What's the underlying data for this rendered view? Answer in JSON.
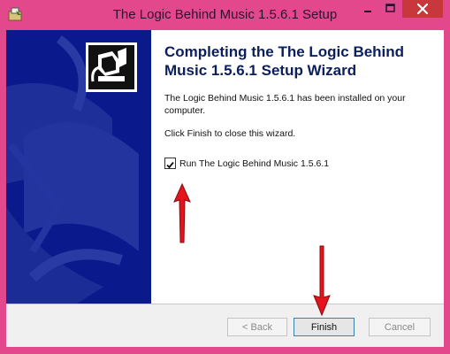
{
  "window": {
    "title": "The Logic Behind Music 1.5.6.1 Setup"
  },
  "wizard": {
    "heading": "Completing the The Logic Behind Music 1.5.6.1 Setup Wizard",
    "installed_text": "The Logic Behind Music 1.5.6.1 has been installed on your computer.",
    "instruction_text": "Click Finish to close this wizard.",
    "run_checkbox": {
      "label": "Run The Logic Behind Music 1.5.6.1",
      "checked": true
    }
  },
  "buttons": {
    "back": "< Back",
    "finish": "Finish",
    "cancel": "Cancel"
  },
  "icons": [
    "installer-icon",
    "minimize-icon",
    "maximize-icon",
    "close-icon",
    "setup-computer-icon",
    "annotation-arrow-icon"
  ],
  "colors": {
    "titlebar": "#e3488c",
    "banner": "#0a1a8c",
    "close_button": "#c7373b",
    "annotation_arrow": "#e3141b"
  }
}
